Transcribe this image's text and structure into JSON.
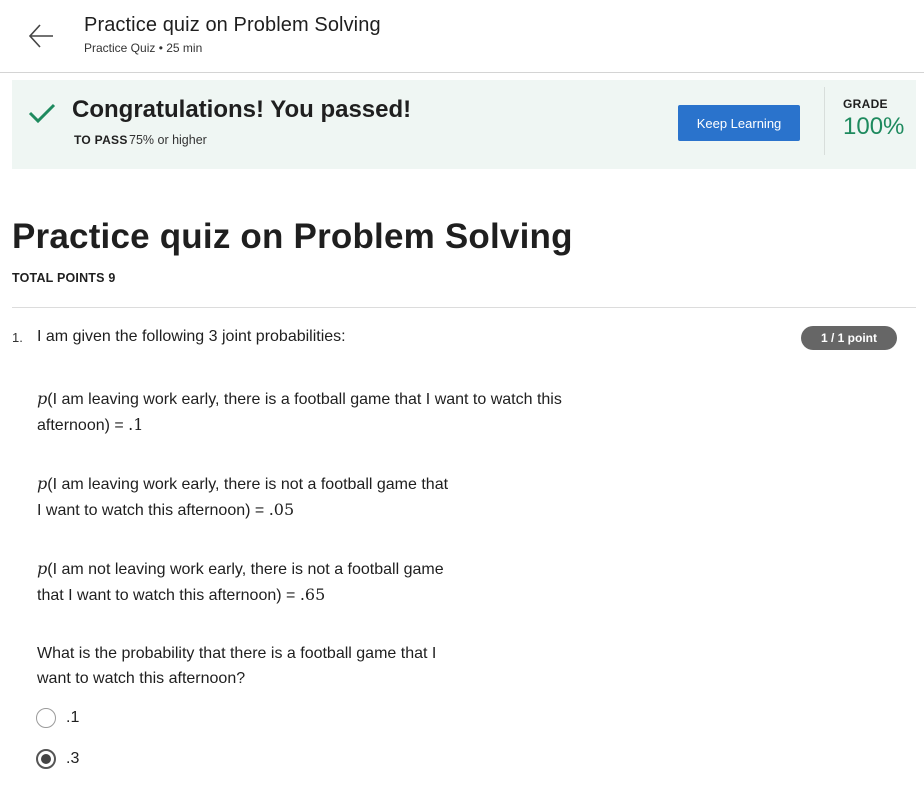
{
  "header": {
    "title": "Practice quiz on Problem Solving",
    "subtitle": "Practice Quiz • 25 min",
    "back_icon": "arrow-left-icon"
  },
  "banner": {
    "icon": "check-icon",
    "title": "Congratulations! You passed!",
    "to_pass_label": "TO PASS",
    "to_pass_value": "75% or higher",
    "keep_learning_label": "Keep Learning",
    "grade_label": "GRADE",
    "grade_value": "100%",
    "accent_color": "#1e8a5e",
    "button_color": "#2a73cc"
  },
  "quiz": {
    "title": "Practice quiz on Problem Solving",
    "total_points": "TOTAL POINTS 9"
  },
  "question": {
    "number": "1.",
    "prompt": "I am given the following 3 joint probabilities:",
    "points_badge": "1 / 1 point",
    "p_symbol": "p",
    "prob1_line1": "(I am leaving work early, there is a football game that I want to watch this",
    "prob1_line2": "afternoon) = ",
    "prob1_value": ".1",
    "prob2_line1": "(I am leaving work early, there is not a football game that",
    "prob2_line2": "I want to watch this afternoon) = ",
    "prob2_value": ".05",
    "prob3_line1": "(I am not leaving work early, there is not a football game",
    "prob3_line2": "that I want to watch this afternoon) = ",
    "prob3_value": ".65",
    "ask_line1": "What is the probability that there is a football game that I",
    "ask_line2": "want to watch this afternoon?",
    "options": [
      {
        "label": ".1",
        "selected": false
      },
      {
        "label": ".3",
        "selected": true
      }
    ]
  }
}
